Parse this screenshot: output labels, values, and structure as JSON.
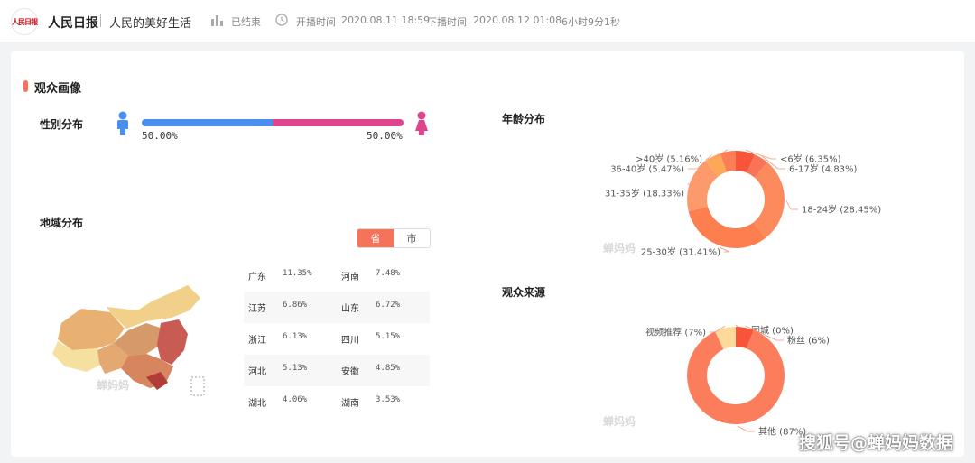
{
  "header": {
    "logo_text": "人民日報",
    "brand": "人民日报",
    "slogan": "人民的美好生活",
    "status": "已结束",
    "start_label": "开播时间",
    "start_time": "2020.08.11 18:59",
    "end_label": "下播时间",
    "end_time": "2020.08.12 01:08",
    "duration": "6小时9分1秒"
  },
  "section_title": "观众画像",
  "gender": {
    "label": "性别分布",
    "male_pct": "50.00%",
    "female_pct": "50.00%",
    "male_share": 0.5,
    "male_color": "#4a8ff0",
    "female_color": "#e0448e"
  },
  "region": {
    "label": "地域分布",
    "tabs": [
      "省",
      "市"
    ],
    "active_tab": "省",
    "accent": "#f5735a",
    "rows": [
      [
        {
          "name": "广东",
          "pct": "11.35%"
        },
        {
          "name": "河南",
          "pct": "7.48%"
        }
      ],
      [
        {
          "name": "江苏",
          "pct": "6.86%"
        },
        {
          "name": "山东",
          "pct": "6.72%"
        }
      ],
      [
        {
          "name": "浙江",
          "pct": "6.13%"
        },
        {
          "name": "四川",
          "pct": "5.15%"
        }
      ],
      [
        {
          "name": "河北",
          "pct": "5.13%"
        },
        {
          "name": "安徽",
          "pct": "4.85%"
        }
      ],
      [
        {
          "name": "湖北",
          "pct": "4.06%"
        },
        {
          "name": "湖南",
          "pct": "3.53%"
        }
      ]
    ]
  },
  "watermark": "蝉妈妈",
  "corner_text": "搜狐号@蝉妈妈数据",
  "chart_data": [
    {
      "type": "pie",
      "title": "年龄分布",
      "donut": true,
      "slices": [
        {
          "label": "<6岁 (6.35%)",
          "value": 6.35,
          "color": "#f7543a"
        },
        {
          "label": "6-17岁 (4.83%)",
          "value": 4.83,
          "color": "#fb7356"
        },
        {
          "label": "18-24岁 (28.45%)",
          "value": 28.45,
          "color": "#fd8a5c"
        },
        {
          "label": "25-30岁 (31.41%)",
          "value": 31.41,
          "color": "#fd7e4f"
        },
        {
          "label": "31-35岁 (18.33%)",
          "value": 18.33,
          "color": "#fd9a6b"
        },
        {
          "label": "36-40岁 (5.47%)",
          "value": 5.47,
          "color": "#fca858"
        },
        {
          "label": ">40岁 (5.16%)",
          "value": 5.16,
          "color": "#fb7e56"
        }
      ]
    },
    {
      "type": "pie",
      "title": "观众来源",
      "donut": true,
      "slices": [
        {
          "label": "同城 (0%)",
          "value": 0,
          "color": "#f04a2c"
        },
        {
          "label": "粉丝 (6%)",
          "value": 6,
          "color": "#f7543a"
        },
        {
          "label": "其他 (87%)",
          "value": 87,
          "color": "#fb7d5b"
        },
        {
          "label": "视频推荐 (7%)",
          "value": 7,
          "color": "#fdd99a"
        }
      ]
    }
  ]
}
